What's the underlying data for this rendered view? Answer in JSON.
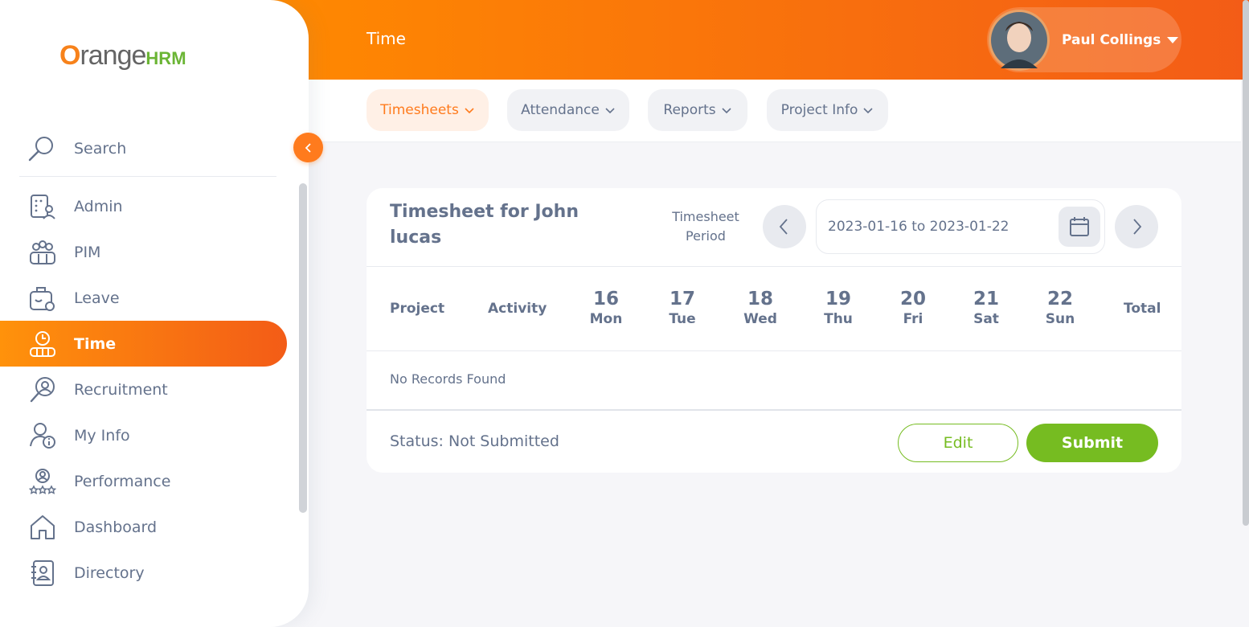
{
  "brand": {
    "first": "O",
    "rest": "range",
    "suffix": "HRM"
  },
  "sidebar": {
    "search_label": "Search",
    "items": [
      {
        "label": "Admin",
        "icon": "admin-icon"
      },
      {
        "label": "PIM",
        "icon": "pim-icon"
      },
      {
        "label": "Leave",
        "icon": "leave-icon"
      },
      {
        "label": "Time",
        "icon": "time-icon"
      },
      {
        "label": "Recruitment",
        "icon": "recruitment-icon"
      },
      {
        "label": "My Info",
        "icon": "my-info-icon"
      },
      {
        "label": "Performance",
        "icon": "performance-icon"
      },
      {
        "label": "Dashboard",
        "icon": "dashboard-icon"
      },
      {
        "label": "Directory",
        "icon": "directory-icon"
      }
    ],
    "active_item": "Time"
  },
  "header": {
    "module_title": "Time",
    "user_name": "Paul Collings"
  },
  "subnav": {
    "tabs": [
      "Timesheets",
      "Attendance",
      "Reports",
      "Project Info"
    ],
    "active_tab": "Timesheets"
  },
  "timesheet": {
    "title": "Timesheet for John lucas",
    "period_label": "Timesheet Period",
    "period_value": "2023-01-16 to 2023-01-22",
    "columns": {
      "project": "Project",
      "activity": "Activity",
      "total": "Total"
    },
    "days": [
      {
        "num": "16",
        "name": "Mon"
      },
      {
        "num": "17",
        "name": "Tue"
      },
      {
        "num": "18",
        "name": "Wed"
      },
      {
        "num": "19",
        "name": "Thu"
      },
      {
        "num": "20",
        "name": "Fri"
      },
      {
        "num": "21",
        "name": "Sat"
      },
      {
        "num": "22",
        "name": "Sun"
      }
    ],
    "empty_message": "No Records Found",
    "status": "Status: Not Submitted",
    "edit_label": "Edit",
    "submit_label": "Submit"
  },
  "colors": {
    "accent": "#ff7b1d",
    "gradient_start": "#ff920b",
    "gradient_end": "#f35c17",
    "success": "#76bc21",
    "text": "#64728c"
  }
}
